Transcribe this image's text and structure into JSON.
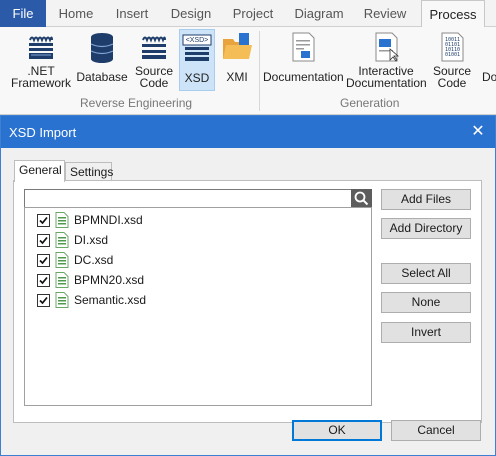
{
  "ribbon": {
    "tabs": [
      {
        "label": "File"
      },
      {
        "label": "Home"
      },
      {
        "label": "Insert"
      },
      {
        "label": "Design"
      },
      {
        "label": "Project"
      },
      {
        "label": "Diagram"
      },
      {
        "label": "Review"
      },
      {
        "label": "Process"
      }
    ],
    "active_tab": "Process",
    "buttons": {
      "net_framework": ".NET\nFramework",
      "net_line1": ".NET",
      "net_line2": "Framework",
      "database": "Database",
      "source_code_line1": "Source",
      "source_code_line2": "Code",
      "xsd": "XSD",
      "xsd_badge": "<XSD>",
      "xmi": "XMI",
      "documentation": "Documentation",
      "interactive_line1": "Interactive",
      "interactive_line2": "Documentation",
      "gen_source_line1": "Source",
      "gen_source_line2": "Code",
      "cut_label": "Do"
    },
    "groups": {
      "reverse_engineering": "Reverse Engineering",
      "generation": "Generation"
    },
    "colors": {
      "file_tab": "#2a5aa8",
      "selected_button": "#cde3f7"
    }
  },
  "dialog": {
    "title": "XSD Import",
    "close_glyph": "✕",
    "tabs": [
      {
        "label": "General"
      },
      {
        "label": "Settings"
      }
    ],
    "active_tab": "General",
    "search": {
      "value": "",
      "placeholder": ""
    },
    "files": [
      {
        "name": "BPMNDI.xsd",
        "checked": true
      },
      {
        "name": "DI.xsd",
        "checked": true
      },
      {
        "name": "DC.xsd",
        "checked": true
      },
      {
        "name": "BPMN20.xsd",
        "checked": true
      },
      {
        "name": "Semantic.xsd",
        "checked": true
      }
    ],
    "buttons": {
      "add_files": "Add Files",
      "add_directory": "Add Directory",
      "select_all": "Select All",
      "none": "None",
      "invert": "Invert",
      "ok": "OK",
      "cancel": "Cancel"
    },
    "colors": {
      "titlebar": "#2a72d0",
      "default_border": "#0078d7"
    }
  }
}
